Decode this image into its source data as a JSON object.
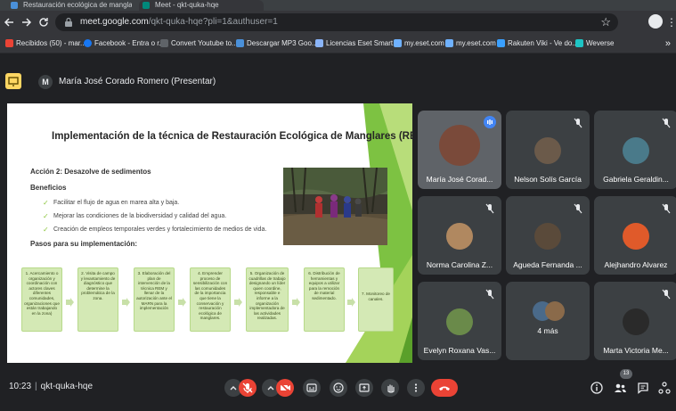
{
  "browser": {
    "tabs": [
      {
        "label": "Restauración ecológica de manglares"
      },
      {
        "label": "Meet - qkt-quka-hqe"
      }
    ],
    "url_host": "meet.google.com",
    "url_path": "/qkt-quka-hqe?pli=1&authuser=1",
    "bookmarks": [
      {
        "label": "Recibidos (50) - mar...",
        "color": "#ea4335"
      },
      {
        "label": "Facebook - Entra o r...",
        "color": "#1877f2"
      },
      {
        "label": "Convert Youtube to...",
        "color": "#5f6368"
      },
      {
        "label": "Descargar MP3 Goo...",
        "color": "#4a90d9"
      },
      {
        "label": "Licencias Eset Smart...",
        "color": "#8ab4f8"
      },
      {
        "label": "my.eset.com",
        "color": "#6fb1ff"
      },
      {
        "label": "my.eset.com",
        "color": "#6fb1ff"
      },
      {
        "label": "Rakuten Viki - Ve do...",
        "color": "#3aa0ff"
      },
      {
        "label": "Weverse",
        "color": "#1ec4c4"
      }
    ],
    "bookmarks_more": "»"
  },
  "meet": {
    "presenter_initial": "M",
    "presenter_label": "María José Corado Romero (Presentar)",
    "meeting_time": "10:23",
    "meeting_code": "qkt-quka-hqe",
    "participant_count": "13",
    "accent": "#8ab4f8",
    "danger": "#ea4335"
  },
  "slide": {
    "title": "Implementación de la técnica de Restauración Ecológica de Manglares (REM)",
    "action": "Acción 2: Desazolve de sedimentos",
    "benefits_heading": "Beneficios",
    "benefits": [
      "Facilitar el flujo de agua en marea alta y baja.",
      "Mejorar las condiciones de la biodiversidad y calidad del agua.",
      "Creación de empleos temporales verdes y fortalecimiento de medios de vida."
    ],
    "steps_heading": "Pasos para su implementación:",
    "steps": [
      "1. Acercamiento o organización y coordinación con actores claves diferentes comunidades, organizaciones que están trabajando en la zona)",
      "2. Visita de campo y levantamiento de diagnóstico que determine la problemática de la zona.",
      "3. Elaboración del plan de intervención de la técnica REM y llenar de la autorización ante el MARN para la implementación",
      "4. Emprender proceso de sensibilización con las comunidades de la importancia que tiene la conservación y restauración ecológica de manglares.",
      "5. Organización de cuadrillas de trabajo designando un líder quien coordine, responsable e informe a la organización implementadora de las actividades realizadas.",
      "6. Distribución de herramientas y equipos a utilizar para la remoción de material sedimentado.",
      "7. Monitoreo de canales."
    ]
  },
  "participants": [
    {
      "name": "María José Corad...",
      "speaking": true,
      "avatar_color": "#7a4a3a"
    },
    {
      "name": "Nelson Solís García",
      "speaking": false,
      "avatar_color": "#6b5a4a"
    },
    {
      "name": "Gabriela Geraldin...",
      "speaking": false,
      "avatar_color": "#4a7a8a"
    },
    {
      "name": "Norma Carolina Z...",
      "speaking": false,
      "avatar_color": "#b08860"
    },
    {
      "name": "Agueda Fernanda ...",
      "speaking": false,
      "avatar_color": "#5a4a3a"
    },
    {
      "name": "Alejhandro Alvarez",
      "speaking": false,
      "avatar_color": "#e05a2a"
    },
    {
      "name": "Evelyn Roxana Vas...",
      "speaking": false,
      "avatar_color": "#6a8a4a"
    },
    {
      "name": "4 más",
      "speaking": false,
      "avatar_color": "#4a6a8a"
    },
    {
      "name": "Marta Victoria Me...",
      "speaking": false,
      "avatar_color": "#2a2a2a"
    }
  ]
}
